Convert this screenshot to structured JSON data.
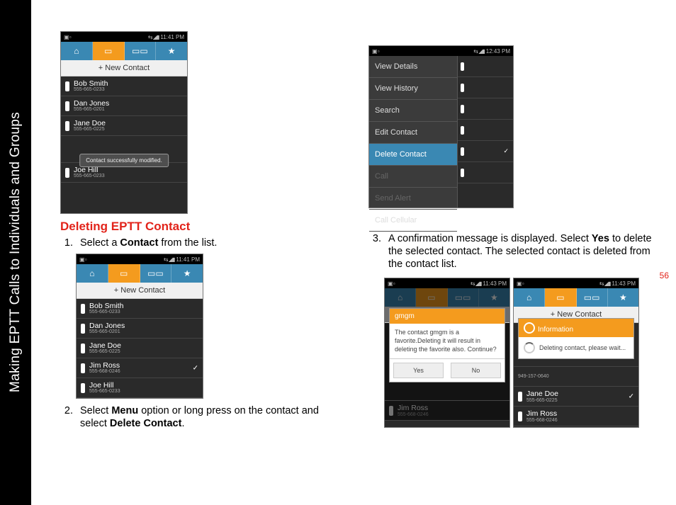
{
  "sidebar_title": "Making EPTT Calls to Individuals and Groups",
  "page_number": "56",
  "section_heading": "Deleting EPTT Contact",
  "steps": {
    "s1_pre": "Select a ",
    "s1_bold": "Contact",
    "s1_post": " from the list.",
    "s2_a": "Select ",
    "s2_b": "Menu",
    "s2_c": " option or long press on the contact and select ",
    "s2_d": "Delete Contact",
    "s2_e": ".",
    "s3_a": "A confirmation message is displayed. Select ",
    "s3_b": "Yes",
    "s3_c": " to delete the selected contact. The selected contact is deleted from the contact list."
  },
  "phone": {
    "time1": "11:41 PM",
    "time2": "12:43 PM",
    "time3": "11:43 PM",
    "new_contact": "+ New Contact",
    "toast": "Contact successfully modified.",
    "contacts": [
      {
        "name": "Bob Smith",
        "num": "555-665-0233"
      },
      {
        "name": "Dan Jones",
        "num": "555-665-0201"
      },
      {
        "name": "Jane Doe",
        "num": "555-665-0225"
      },
      {
        "name": "Joe Hill",
        "num": "555-665-0233"
      }
    ],
    "contacts2": [
      {
        "name": "Bob Smith",
        "num": "555-665-0233"
      },
      {
        "name": "Dan Jones",
        "num": "555-665-0201"
      },
      {
        "name": "Jane Doe",
        "num": "555-665-0225"
      },
      {
        "name": "Jim Ross",
        "num": "555-668-0246",
        "check": true
      },
      {
        "name": "Joe Hill",
        "num": "555-665-0233"
      }
    ],
    "ctx_menu": [
      {
        "label": "View Details"
      },
      {
        "label": "View History"
      },
      {
        "label": "Search"
      },
      {
        "label": "Edit Contact"
      },
      {
        "label": "Delete Contact",
        "sel": true
      },
      {
        "label": "Call",
        "dis": true
      },
      {
        "label": "Send Alert",
        "dis": true
      },
      {
        "label": "Call Cellular"
      }
    ],
    "dialog": {
      "title": "gmgm",
      "body": "The contact gmgm is a favorite.Deleting it will result in deleting the favorite also. Continue?",
      "yes": "Yes",
      "no": "No"
    },
    "info_dialog": {
      "title": "Information",
      "body": "Deleting contact, please wait..."
    },
    "contacts3_after": [
      {
        "name": "Jane Doe",
        "num": "555-665-0225",
        "check": true
      },
      {
        "name": "Jim Ross",
        "num": "555-668-0246"
      }
    ],
    "dim_num": "949-157-0640"
  }
}
